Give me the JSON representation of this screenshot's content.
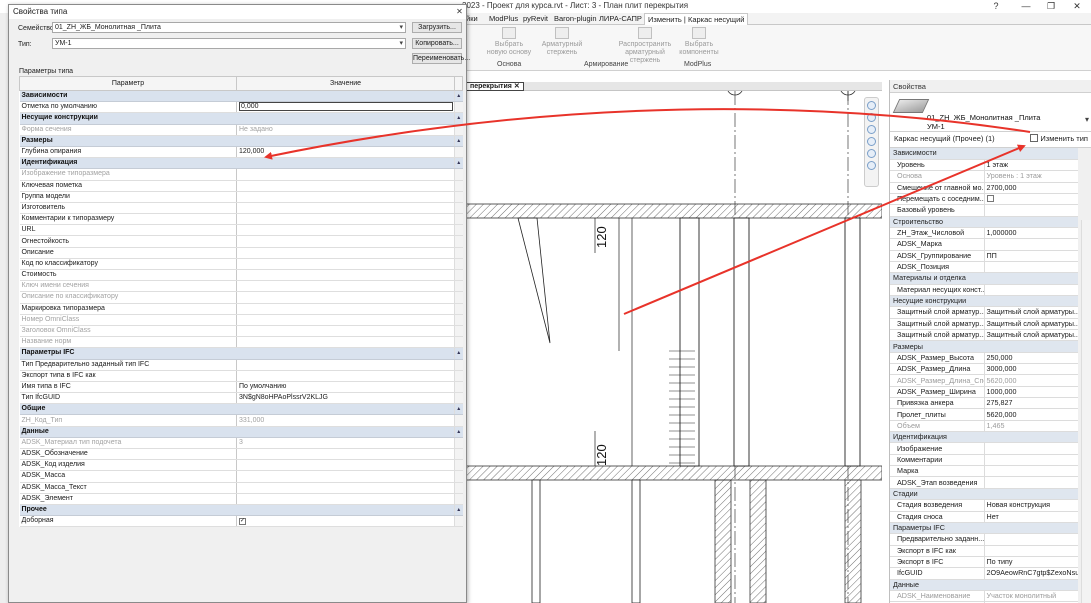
{
  "app": {
    "window_title": "2023 - Проект для курса.rvt - Лист: 3 - План плит перекрытия",
    "window_buttons": [
      "?",
      "—",
      "❐",
      "✕"
    ]
  },
  "ribbon": {
    "tabs": [
      "йки",
      "ModPlus",
      "pyRevit",
      "Baron-plugin",
      "ЛИРА-САПР",
      "Изменить | Каркас несущий"
    ],
    "active_tab_index": 5,
    "buttons": [
      "Выбрать новую основу",
      "Арматурный стержень",
      "Распространить арматурный стержень",
      "Выбрать компоненты"
    ],
    "groups": [
      "Основа",
      "Армирование",
      "ModPlus"
    ]
  },
  "view": {
    "tab_label": "перекрытия",
    "dim_labels": [
      "120",
      "120"
    ]
  },
  "dialog": {
    "title": "Свойства типа",
    "family_label": "Семейство:",
    "family_value": "01_ZH_ЖБ_Монолитная _Плита",
    "type_label": "Тип:",
    "type_value": "УМ-1",
    "load_button": "Загрузить...",
    "copy_button": "Копировать...",
    "rename_button": "Переименовать...",
    "params_caption": "Параметры типа",
    "col_param": "Параметр",
    "col_value": "Значение",
    "rows": [
      {
        "kind": "group",
        "label": "Зависимости"
      },
      {
        "kind": "param",
        "label": "Отметка по умолчанию",
        "value": "0,000",
        "edit": true
      },
      {
        "kind": "group",
        "label": "Несущие конструкции"
      },
      {
        "kind": "param",
        "label": "Форма сечения",
        "value": "Не задано",
        "disabled": true
      },
      {
        "kind": "group",
        "label": "Размеры"
      },
      {
        "kind": "param",
        "label": "Глубина опирания",
        "value": "120,000"
      },
      {
        "kind": "group",
        "label": "Идентификация"
      },
      {
        "kind": "param",
        "label": "Изображение типоразмера",
        "value": "",
        "disabled": true
      },
      {
        "kind": "param",
        "label": "Ключевая пометка",
        "value": ""
      },
      {
        "kind": "param",
        "label": "Группа модели",
        "value": ""
      },
      {
        "kind": "param",
        "label": "Изготовитель",
        "value": ""
      },
      {
        "kind": "param",
        "label": "Комментарии к типоразмеру",
        "value": ""
      },
      {
        "kind": "param",
        "label": "URL",
        "value": ""
      },
      {
        "kind": "param",
        "label": "Огнестойкость",
        "value": ""
      },
      {
        "kind": "param",
        "label": "Описание",
        "value": ""
      },
      {
        "kind": "param",
        "label": "Код по классификатору",
        "value": ""
      },
      {
        "kind": "param",
        "label": "Стоимость",
        "value": ""
      },
      {
        "kind": "param",
        "label": "Ключ имени сечения",
        "value": "",
        "disabled": true
      },
      {
        "kind": "param",
        "label": "Описание по классификатору",
        "value": "",
        "disabled": true
      },
      {
        "kind": "param",
        "label": "Маркировка типоразмера",
        "value": ""
      },
      {
        "kind": "param",
        "label": "Номер OmniClass",
        "value": "",
        "disabled": true
      },
      {
        "kind": "param",
        "label": "Заголовок OmniClass",
        "value": "",
        "disabled": true
      },
      {
        "kind": "param",
        "label": "Название норм",
        "value": "",
        "disabled": true
      },
      {
        "kind": "group",
        "label": "Параметры IFC"
      },
      {
        "kind": "param",
        "label": "Тип Предварительно заданный тип IFC",
        "value": ""
      },
      {
        "kind": "param",
        "label": "Экспорт типа в IFC как",
        "value": ""
      },
      {
        "kind": "param",
        "label": "Имя типа в IFC",
        "value": "По умолчанию"
      },
      {
        "kind": "param",
        "label": "Тип IfcGUID",
        "value": "3N$gN8oHPAoPlssrV2KLJG"
      },
      {
        "kind": "group",
        "label": "Общие"
      },
      {
        "kind": "param",
        "label": "ZH_Код_Тип",
        "value": "331,000",
        "disabled": true
      },
      {
        "kind": "group",
        "label": "Данные"
      },
      {
        "kind": "param",
        "label": "ADSK_Материал тип подочета",
        "value": "3",
        "disabled": true
      },
      {
        "kind": "param",
        "label": "ADSK_Обозначение",
        "value": ""
      },
      {
        "kind": "param",
        "label": "ADSK_Код изделия",
        "value": ""
      },
      {
        "kind": "param",
        "label": "ADSK_Масса",
        "value": ""
      },
      {
        "kind": "param",
        "label": "ADSK_Масса_Текст",
        "value": ""
      },
      {
        "kind": "param",
        "label": "ADSK_Элемент",
        "value": ""
      },
      {
        "kind": "group",
        "label": "Прочее"
      },
      {
        "kind": "param",
        "label": "Доборная",
        "value": "",
        "checkbox": true
      }
    ]
  },
  "properties": {
    "header": "Свойства",
    "family_name": "01_ZH_ЖБ_Монолитная _Плита",
    "type_name": "УМ-1",
    "filter_label": "Каркас несущий (Прочее) (1)",
    "edit_type_label": "Изменить тип",
    "rows": [
      {
        "kind": "group",
        "label": "Зависимости"
      },
      {
        "kind": "param",
        "label": "Уровень",
        "value": "1 этаж"
      },
      {
        "kind": "param",
        "label": "Основа",
        "value": "Уровень : 1 этаж",
        "disabled": true
      },
      {
        "kind": "param",
        "label": "Смещение от главной мо...",
        "value": "2700,000"
      },
      {
        "kind": "param",
        "label": "Перемещать с соседним...",
        "value": "",
        "checkbox": true
      },
      {
        "kind": "param",
        "label": "Базовый уровень",
        "value": ""
      },
      {
        "kind": "group",
        "label": "Строительство"
      },
      {
        "kind": "param",
        "label": "ZH_Этаж_Числовой",
        "value": "1,000000"
      },
      {
        "kind": "param",
        "label": "ADSK_Марка",
        "value": ""
      },
      {
        "kind": "param",
        "label": "ADSK_Группирование",
        "value": "ПП"
      },
      {
        "kind": "param",
        "label": "ADSK_Позиция",
        "value": ""
      },
      {
        "kind": "group",
        "label": "Материалы и отделка"
      },
      {
        "kind": "param",
        "label": "Материал несущих конст...",
        "value": ""
      },
      {
        "kind": "group",
        "label": "Несущие конструкции"
      },
      {
        "kind": "param",
        "label": "Защитный слой арматур...",
        "value": "Защитный слой арматуры..."
      },
      {
        "kind": "param",
        "label": "Защитный слой арматур...",
        "value": "Защитный слой арматуры..."
      },
      {
        "kind": "param",
        "label": "Защитный слой арматур...",
        "value": "Защитный слой арматуры..."
      },
      {
        "kind": "group",
        "label": "Размеры"
      },
      {
        "kind": "param",
        "label": "ADSK_Размер_Высота",
        "value": "250,000"
      },
      {
        "kind": "param",
        "label": "ADSK_Размер_Длина",
        "value": "3000,000"
      },
      {
        "kind": "param",
        "label": "ADSK_Размер_Длина_Спец",
        "value": "5620,000",
        "disabled": true
      },
      {
        "kind": "param",
        "label": "ADSK_Размер_Ширина",
        "value": "1000,000"
      },
      {
        "kind": "param",
        "label": "Привязка анкера",
        "value": "275,827"
      },
      {
        "kind": "param",
        "label": "Пролет_плиты",
        "value": "5620,000"
      },
      {
        "kind": "param",
        "label": "Объем",
        "value": "1,465",
        "disabled": true
      },
      {
        "kind": "group",
        "label": "Идентификация"
      },
      {
        "kind": "param",
        "label": "Изображение",
        "value": ""
      },
      {
        "kind": "param",
        "label": "Комментарии",
        "value": ""
      },
      {
        "kind": "param",
        "label": "Марка",
        "value": ""
      },
      {
        "kind": "param",
        "label": "ADSK_Этап возведения",
        "value": ""
      },
      {
        "kind": "group",
        "label": "Стадии"
      },
      {
        "kind": "param",
        "label": "Стадия возведения",
        "value": "Новая конструкция"
      },
      {
        "kind": "param",
        "label": "Стадия сноса",
        "value": "Нет"
      },
      {
        "kind": "group",
        "label": "Параметры IFC"
      },
      {
        "kind": "param",
        "label": "Предварительно заданн...",
        "value": ""
      },
      {
        "kind": "param",
        "label": "Экспорт в IFC как",
        "value": ""
      },
      {
        "kind": "param",
        "label": "Экспорт в IFC",
        "value": "По типу"
      },
      {
        "kind": "param",
        "label": "IfcGUID",
        "value": "2O9AeowRnC7gtp$ZexoNsu"
      },
      {
        "kind": "group",
        "label": "Данные"
      },
      {
        "kind": "param",
        "label": "ADSK_Наименование",
        "value": "Участок монолитный",
        "disabled": true
      },
      {
        "kind": "param",
        "label": "ADSK_Масса элемента",
        "value": "2060,000 кг",
        "disabled": true
      }
    ]
  },
  "colors": {
    "annotation_arrow": "#e8332a",
    "group_header": "#d9e2ee",
    "hatch": "#333333"
  },
  "icons": [
    "close-icon",
    "chevron-down-icon",
    "edit-type-icon",
    "zoom-icon",
    "pan-icon",
    "checkbox-icon"
  ]
}
